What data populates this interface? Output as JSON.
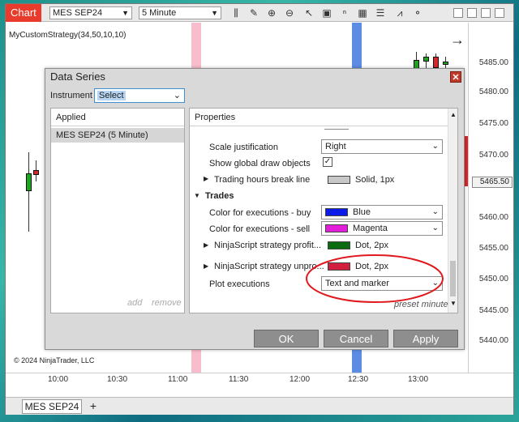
{
  "toolbar": {
    "chart_tab": "Chart",
    "instrument": "MES SEP24",
    "interval": "5 Minute"
  },
  "chart": {
    "indicator_label": "MyCustomStrategy(34,50,10,10)",
    "copyright": "© 2024 NinjaTrader, LLC",
    "price_labels": [
      "5485.00",
      "5480.00",
      "5475.00",
      "5470.00",
      "5460.00",
      "5455.00",
      "5450.00",
      "5445.00",
      "5440.00"
    ],
    "current_price": "5465.50",
    "time_labels": [
      "10:00",
      "10:30",
      "11:00",
      "11:30",
      "12:00",
      "12:30",
      "13:00"
    ],
    "band_colors": {
      "pink": "#f7b6c6",
      "blue": "#4a7fe0"
    },
    "up_color": "#1fa51f",
    "down_color": "#d8262a"
  },
  "dialog": {
    "title": "Data Series",
    "instrument_label": "Instrument",
    "instrument_value": "Select",
    "applied_header": "Applied",
    "applied_item": "MES SEP24 (5 Minute)",
    "add_label": "add",
    "remove_label": "remove",
    "properties_header": "Properties",
    "rows": {
      "scale_justification": {
        "label": "Scale justification",
        "value": "Right"
      },
      "show_global": {
        "label": "Show global draw objects",
        "value": "✓"
      },
      "trading_hours": {
        "label": "Trading hours break line",
        "value": "Solid, 1px",
        "color": "#c8c8c8"
      },
      "trades_section": "Trades",
      "color_buy": {
        "label": "Color for executions - buy",
        "value": "Blue",
        "color": "#0b1be8"
      },
      "color_sell": {
        "label": "Color for executions - sell",
        "value": "Magenta",
        "color": "#e21ed9"
      },
      "profit": {
        "label": "NinjaScript strategy profit...",
        "value": "Dot, 2px",
        "color": "#0a6b10"
      },
      "unpro": {
        "label": "NinjaScript strategy unpro...",
        "value": "Dot, 2px",
        "color": "#d21f3e"
      },
      "plot_exec": {
        "label": "Plot executions",
        "value": "Text and marker"
      }
    },
    "preset": "preset minute",
    "ok": "OK",
    "cancel": "Cancel",
    "apply": "Apply"
  },
  "bottom_tabs": {
    "tab": "MES SEP24",
    "add": "+"
  }
}
